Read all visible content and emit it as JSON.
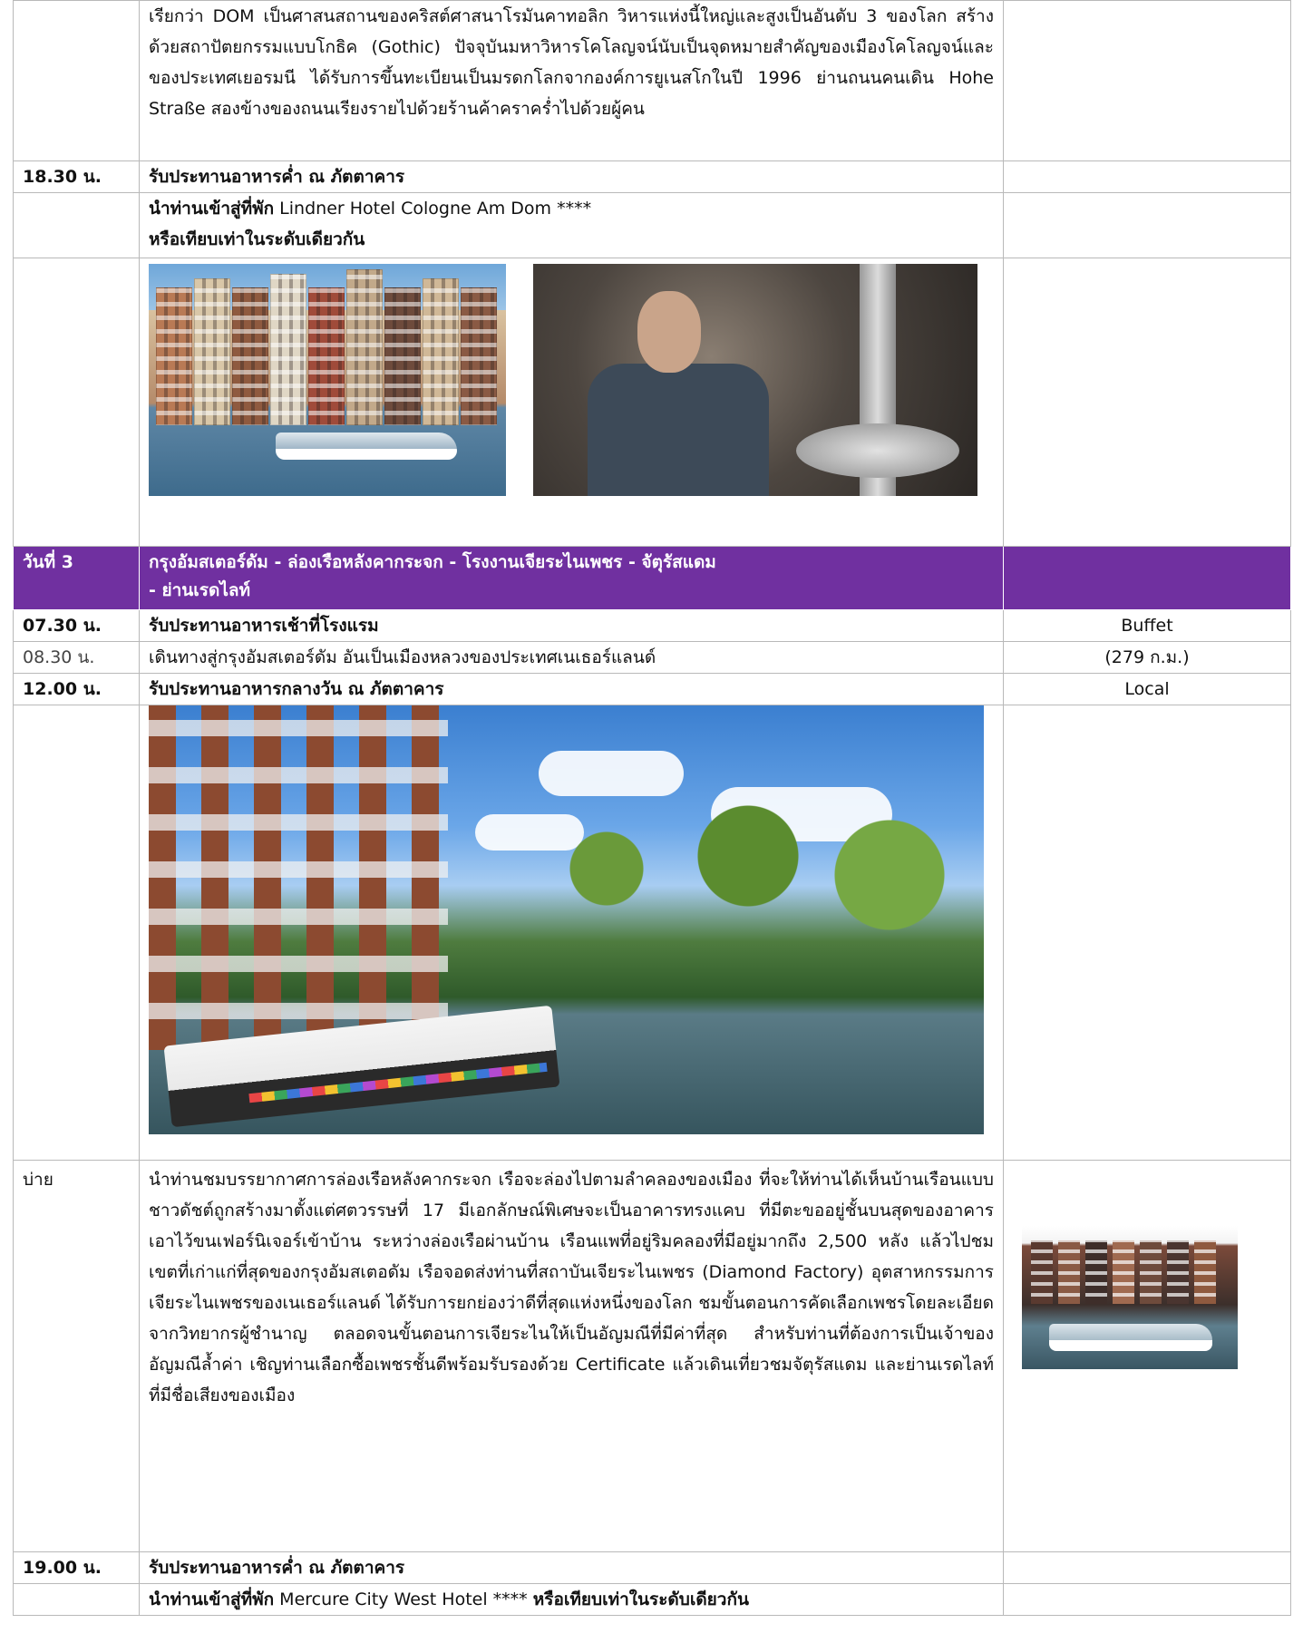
{
  "rows": {
    "intro_paragraph": "เรียกว่า DOM เป็นศาสนสถานของคริสต์ศาสนาโรมันคาทอลิก วิหารแห่งนี้ใหญ่และสูงเป็นอันดับ 3 ของโลก สร้างด้วยสถาปัตยกรรมแบบโกธิค (Gothic) ปัจจุบันมหาวิหารโคโลญจน์นับเป็นจุดหมายสำคัญของเมืองโคโลญจน์และของประเทศเยอรมนี ได้รับการขึ้นทะเบียนเป็นมรดกโลกจากองค์การยูเนสโกในปี 1996 ย่านถนนคนเดิน Hohe Straße สองข้างของถนนเรียงรายไปด้วยร้านค้าคราคร่ำไปด้วยผู้คน",
    "dinner_day2_time": "18.30 น.",
    "dinner_day2_text": "รับประทานอาหารค่ำ ณ ภัตตาคาร",
    "hotel_day2_prefix": "นำท่านเข้าสู่ที่พัก",
    "hotel_day2_name": " Lindner Hotel Cologne Am Dom ****",
    "hotel_day2_alt": "หรือเทียบเท่าในระดับเดียวกัน",
    "day3_label": "วันที่ 3",
    "day3_title_line1": "กรุงอัมสเตอร์ดัม - ล่องเรือหลังคากระจก - โรงงานเจียระไนเพชร - จัตุรัสแดม",
    "day3_title_line2": "- ย่านเรดไลท์",
    "breakfast_time": "07.30 น.",
    "breakfast_text": "รับประทานอาหารเช้าที่โรงแรม",
    "breakfast_meal": "Buffet",
    "travel_time": "08.30 น.",
    "travel_text": "เดินทางสู่กรุงอัมสเตอร์ดัม อันเป็นเมืองหลวงของประเทศเนเธอร์แลนด์",
    "travel_distance": "(279 ก.ม.)",
    "lunch_time": "12.00 น.",
    "lunch_text": "รับประทานอาหารกลางวัน ณ ภัตตาคาร",
    "lunch_meal": "Local",
    "afternoon_time": "บ่าย",
    "afternoon_paragraph": "นำท่านชมบรรยากาศการล่องเรือหลังคากระจก เรือจะล่องไปตามลำคลองของเมือง ที่จะให้ท่านได้เห็นบ้านเรือนแบบชาวดัชต์ถูกสร้างมาตั้งแต่ศตวรรษที่ 17 มีเอกลักษณ์พิเศษจะเป็นอาคารทรงแคบ ที่มีตะขออยู่ชั้นบนสุดของอาคารเอาไว้ขนเฟอร์นิเจอร์เข้าบ้าน ระหว่างล่องเรือผ่านบ้าน เรือนแพที่อยู่ริมคลองที่มีอยู่มากถึง 2,500 หลัง แล้วไปชมเขตที่เก่าแก่ที่สุดของกรุงอัมสเตอดัม เรือจอดส่งท่านที่สถาบันเจียระไนเพชร (Diamond Factory) อุตสาหกรรมการเจียระไนเพชรของเนเธอร์แลนด์ ได้รับการยกย่องว่าดีที่สุดแห่งหนึ่งของโลก ชมขั้นตอนการคัดเลือกเพชรโดยละเอียดจากวิทยากรผู้ชำนาญ ตลอดจนขั้นตอนการเจียระไนให้เป็นอัญมณีที่มีค่าที่สุด สำหรับท่านที่ต้องการเป็นเจ้าของอัญมณีล้ำค่า เชิญท่านเลือกซื้อเพชรชั้นดีพร้อมรับรองด้วย Certificate แล้วเดินเที่ยวชมจัตุรัสแดม และย่านเรดไลท์ที่มีชื่อเสียงของเมือง",
    "dinner_day3_time": "19.00 น.",
    "dinner_day3_text": "รับประทานอาหารค่ำ ณ ภัตตาคาร",
    "hotel_day3_prefix": "นำท่านเข้าสู่ที่พัก",
    "hotel_day3_name": " Mercure City West Hotel **** ",
    "hotel_day3_alt": "หรือเทียบเท่าในระดับเดียวกัน"
  },
  "colors": {
    "day_header_bg": "#7030a0",
    "day_header_text": "#ffffff",
    "grid_border": "#b9b9b9"
  },
  "images": {
    "canal_houses_boat": "canal-houses-boat-photo",
    "diamond_workers": "diamond-workers-photo",
    "amsterdam_canal": "amsterdam-canal-photo",
    "houses_boat_small": "canal-houses-small-photo"
  }
}
